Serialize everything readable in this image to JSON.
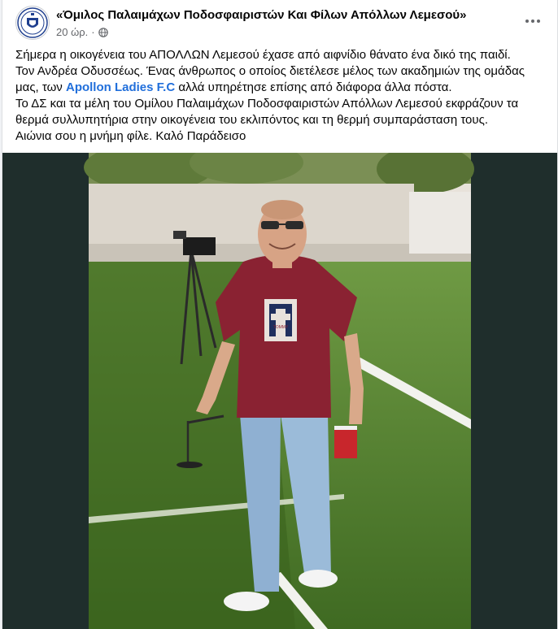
{
  "post": {
    "page_name": "«Όμιλος Παλαιμάχων Ποδοσφαιριστών Και Φίλων Απόλλων Λεμεσού»",
    "timestamp": "20 ώρ.",
    "separator": "·",
    "privacy_icon": "globe-icon",
    "more_icon": "more-horizontal-icon",
    "text": {
      "line1": "Σήμερα η οικογένεια του ΑΠΟΛΛΩΝ Λεμεσού έχασε από αιφνίδιο θάνατο ένα δικό της παιδί.",
      "line2": "Τον Ανδρέα Οδυσσέως. Ένας άνθρωπος ο οποίος διετέλεσε μέλος των ακαδημιών της ομάδας",
      "line3_before": "μας, των ",
      "link": "Apollon Ladies F.C",
      "line3_after": " αλλά υπηρέτησε επίσης από διάφορα άλλα πόστα.",
      "line4": "Το ΔΣ και τα μέλη του Ομίλου Παλαιμάχων Ποδοσφαιριστών Απόλλων Λεμεσού εκφράζουν τα",
      "line5": "θερμά συλλυπητήρια στην οικογένεια του εκλιπόντος και τη θερμή συμπαράσταση τους.",
      "line6": "Αιώνια σου η μνήμη φίλε. Καλό Παράδεισο"
    },
    "photo": {
      "shirt_text": "TOMMY"
    }
  },
  "colors": {
    "link": "#216fdb",
    "shirt": "#8a2232",
    "jeans": "#8fb0d2",
    "grass": "#4e7a2c",
    "backdrop": "#1f2e2c"
  }
}
